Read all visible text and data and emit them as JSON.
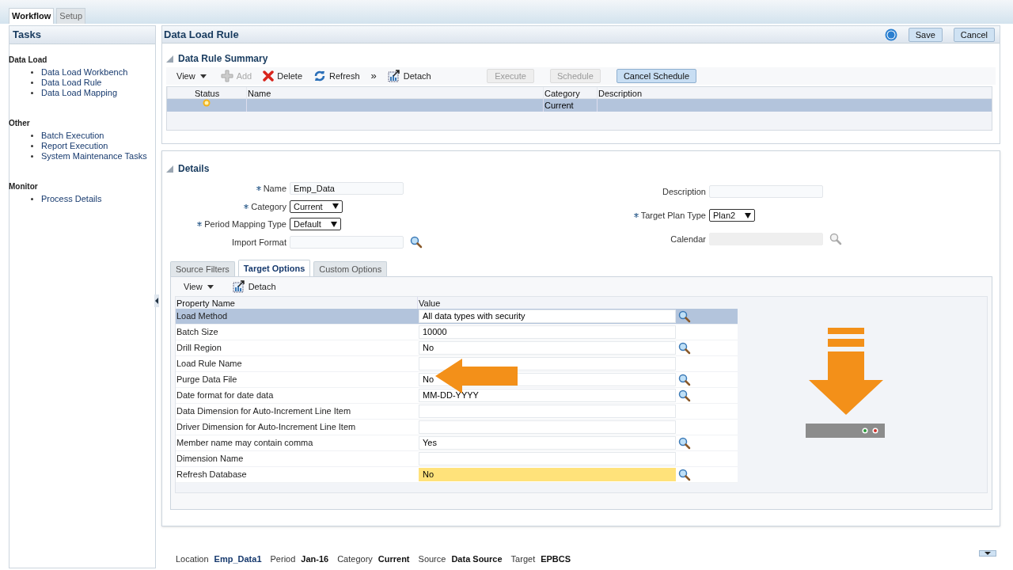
{
  "top_tabs": [
    {
      "label": "Workflow",
      "selected": true
    },
    {
      "label": "Setup",
      "selected": false
    }
  ],
  "sidebar": {
    "title": "Tasks",
    "groups": [
      {
        "heading": "Data Load",
        "items": [
          "Data Load Workbench",
          "Data Load Rule",
          "Data Load Mapping"
        ]
      },
      {
        "heading": "Other",
        "items": [
          "Batch Execution",
          "Report Execution",
          "System Maintenance Tasks"
        ]
      },
      {
        "heading": "Monitor",
        "items": [
          "Process Details"
        ]
      }
    ]
  },
  "main": {
    "title": "Data Load Rule",
    "buttons": [
      "Save",
      "Cancel"
    ]
  },
  "summary": {
    "title": "Data Rule Summary",
    "expanded": true,
    "toolbar": [
      {
        "kind": "view",
        "label": "View",
        "disabled": false
      },
      {
        "kind": "add",
        "label": "Add",
        "disabled": true
      },
      {
        "kind": "delete",
        "label": "Delete",
        "disabled": false
      },
      {
        "kind": "refresh",
        "label": "Refresh",
        "disabled": false
      },
      {
        "kind": "more",
        "label": "»",
        "disabled": false
      },
      {
        "kind": "detach",
        "label": "Detach",
        "disabled": false
      }
    ],
    "actions": [
      {
        "label": "Execute",
        "disabled": true
      },
      {
        "label": "Schedule",
        "disabled": true
      },
      {
        "label": "Cancel Schedule",
        "disabled": false
      }
    ],
    "columns": [
      "Status",
      "Name",
      "Category",
      "Description"
    ],
    "rows": [
      {
        "selected": true,
        "name": "",
        "category": "Current",
        "description": ""
      }
    ]
  },
  "details": {
    "title": "Details",
    "expanded": true,
    "left_fields": [
      {
        "label": "Name",
        "required": true,
        "kind": "text",
        "value": "Emp_Data"
      },
      {
        "label": "Category",
        "required": true,
        "kind": "select",
        "value": "Current"
      },
      {
        "label": "Period Mapping Type",
        "required": true,
        "kind": "select",
        "value": "Default"
      },
      {
        "label": "Import Format",
        "required": false,
        "kind": "lookup"
      }
    ],
    "right_fields": [
      {
        "label": "Description",
        "required": false,
        "kind": "text"
      },
      {
        "label": "Target Plan Type",
        "required": true,
        "kind": "select",
        "value": "Plan2"
      },
      {
        "label": "Calendar",
        "required": false,
        "kind": "lookup",
        "disabled": true
      }
    ],
    "tabs": [
      {
        "label": "Source Filters",
        "selected": false
      },
      {
        "label": "Target Options",
        "selected": true
      },
      {
        "label": "Custom Options",
        "selected": false
      }
    ],
    "toolbar": [
      {
        "kind": "view",
        "label": "View"
      },
      {
        "kind": "detach",
        "label": "Detach"
      }
    ],
    "columns": [
      "Property Name",
      "Value"
    ],
    "properties": [
      {
        "name": "Load Method",
        "value": "All data types with security",
        "lookup": true,
        "selected": true,
        "highlighted": false
      },
      {
        "name": "Batch Size",
        "value": "10000",
        "lookup": false,
        "selected": false,
        "highlighted": false
      },
      {
        "name": "Drill Region",
        "value": "No",
        "lookup": true,
        "selected": false,
        "highlighted": false
      },
      {
        "name": "Load Rule Name",
        "lookup": false,
        "selected": false,
        "highlighted": false
      },
      {
        "name": "Purge Data File",
        "value": "No",
        "lookup": true,
        "selected": false,
        "highlighted": false
      },
      {
        "name": "Date format for date data",
        "value": "MM-DD-YYYY",
        "lookup": true,
        "selected": false,
        "highlighted": false
      },
      {
        "name": "Data Dimension for Auto-Increment Line Item",
        "lookup": false,
        "selected": false,
        "highlighted": false
      },
      {
        "name": "Driver Dimension for Auto-Increment Line Item",
        "lookup": false,
        "selected": false,
        "highlighted": false
      },
      {
        "name": "Member name may contain comma",
        "value": "Yes",
        "lookup": true,
        "selected": false,
        "highlighted": false
      },
      {
        "name": "Dimension Name",
        "lookup": false,
        "selected": false,
        "highlighted": false
      },
      {
        "name": "Refresh Database",
        "value": "No",
        "lookup": true,
        "selected": false,
        "highlighted": true
      }
    ]
  },
  "status_bar": [
    {
      "label": "Location",
      "value": "Emp_Data1",
      "link": true
    },
    {
      "label": "Period",
      "value": "Jan-16",
      "link": false
    },
    {
      "label": "Category",
      "value": "Current",
      "link": false
    },
    {
      "label": "Source",
      "value": "Data Source",
      "link": false
    },
    {
      "label": "Target",
      "value": "EPBCS",
      "link": false
    }
  ]
}
